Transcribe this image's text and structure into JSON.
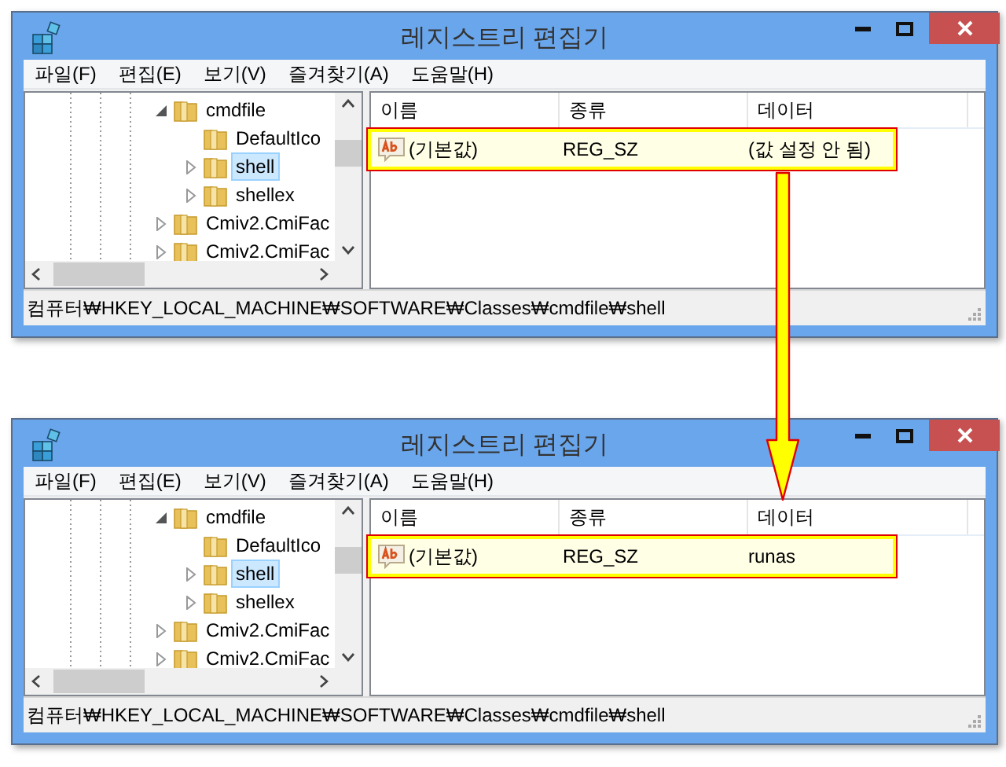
{
  "windows": [
    {
      "title": "레지스트리 편집기",
      "menu": [
        "파일(F)",
        "편집(E)",
        "보기(V)",
        "즐겨찾기(A)",
        "도움말(H)"
      ],
      "tree": [
        {
          "label": "cmdfile",
          "expanded": true,
          "selected": false,
          "children": [
            {
              "label": "DefaultIco",
              "selected": false
            },
            {
              "label": "shell",
              "expanded": false,
              "selected": true
            },
            {
              "label": "shellex",
              "expanded": false,
              "selected": false
            }
          ]
        },
        {
          "label": "Cmiv2.CmiFac",
          "expanded": false,
          "selected": false
        },
        {
          "label": "Cmiv2.CmiFac",
          "expanded": false,
          "selected": false
        }
      ],
      "columns": [
        "이름",
        "종류",
        "데이터"
      ],
      "rows": [
        {
          "name": "(기본값)",
          "type": "REG_SZ",
          "data": "(값 설정 안 됨)",
          "highlighted": true
        }
      ],
      "status_bar": "컴퓨터₩HKEY_LOCAL_MACHINE₩SOFTWARE₩Classes₩cmdfile₩shell"
    },
    {
      "title": "레지스트리 편집기",
      "menu": [
        "파일(F)",
        "편집(E)",
        "보기(V)",
        "즐겨찾기(A)",
        "도움말(H)"
      ],
      "tree": [
        {
          "label": "cmdfile",
          "expanded": true,
          "selected": false,
          "children": [
            {
              "label": "DefaultIco",
              "selected": false
            },
            {
              "label": "shell",
              "expanded": false,
              "selected": true
            },
            {
              "label": "shellex",
              "expanded": false,
              "selected": false
            }
          ]
        },
        {
          "label": "Cmiv2.CmiFac",
          "expanded": false,
          "selected": false
        },
        {
          "label": "Cmiv2.CmiFac",
          "expanded": false,
          "selected": false
        }
      ],
      "columns": [
        "이름",
        "종류",
        "데이터"
      ],
      "rows": [
        {
          "name": "(기본값)",
          "type": "REG_SZ",
          "data": "runas",
          "highlighted": true
        }
      ],
      "status_bar": "컴퓨터₩HKEY_LOCAL_MACHINE₩SOFTWARE₩Classes₩cmdfile₩shell"
    }
  ]
}
